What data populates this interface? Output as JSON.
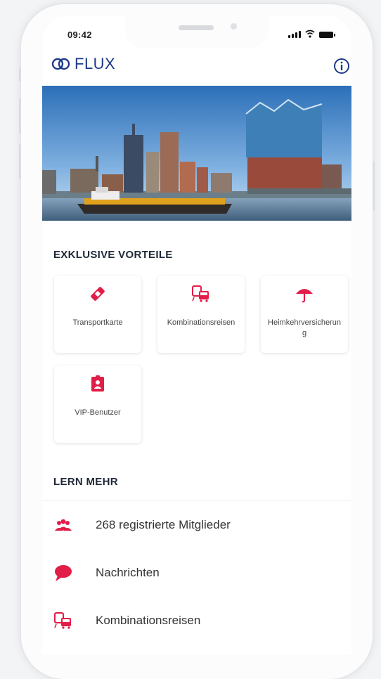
{
  "status": {
    "time": "09:42"
  },
  "app": {
    "brand": "FLUX",
    "accent": "#e11d48",
    "brand_color": "#1e3a8a"
  },
  "sections": {
    "benefits_title": "EXKLUSIVE VORTEILE",
    "learn_title": "LERN MEHR"
  },
  "benefits": [
    {
      "label": "Transportkarte",
      "icon": "ticket-icon"
    },
    {
      "label": "Kombinationsreisen",
      "icon": "train-bus-icon"
    },
    {
      "label": "Heimkehrversicherung",
      "icon": "umbrella-icon"
    },
    {
      "label": "VIP-Benutzer",
      "icon": "badge-icon"
    }
  ],
  "learn_items": [
    {
      "label": "268 registrierte Mitglieder",
      "icon": "members-icon"
    },
    {
      "label": "Nachrichten",
      "icon": "chat-bubble-icon"
    },
    {
      "label": "Kombinationsreisen",
      "icon": "train-bus-icon"
    }
  ]
}
